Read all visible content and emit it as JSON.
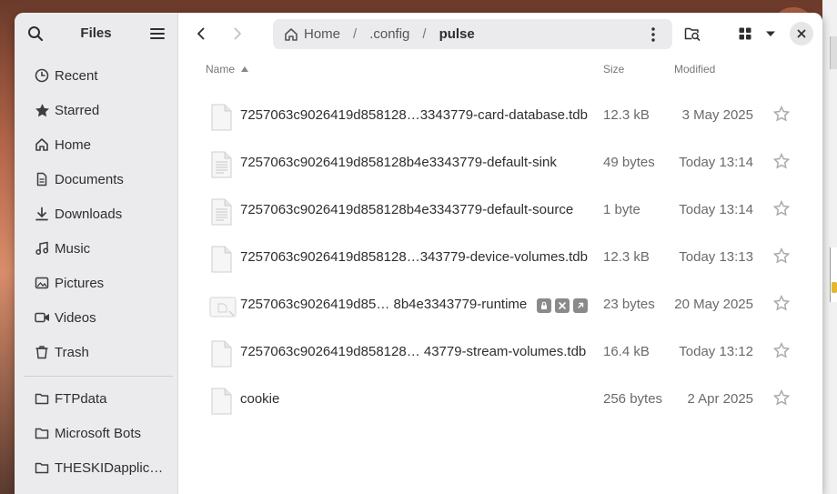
{
  "app": {
    "title": "Files"
  },
  "sidebar": {
    "places": [
      {
        "label": "Recent",
        "icon": "clock-icon"
      },
      {
        "label": "Starred",
        "icon": "star-icon"
      },
      {
        "label": "Home",
        "icon": "home-icon"
      },
      {
        "label": "Documents",
        "icon": "document-icon"
      },
      {
        "label": "Downloads",
        "icon": "download-icon"
      },
      {
        "label": "Music",
        "icon": "music-icon"
      },
      {
        "label": "Pictures",
        "icon": "picture-icon"
      },
      {
        "label": "Videos",
        "icon": "video-icon"
      },
      {
        "label": "Trash",
        "icon": "trash-icon"
      }
    ],
    "bookmarks": [
      {
        "label": "FTPdata",
        "icon": "folder-icon"
      },
      {
        "label": "Microsoft Bots",
        "icon": "folder-icon"
      },
      {
        "label": "THESKIDapplic…",
        "icon": "folder-icon"
      }
    ]
  },
  "pathbar": {
    "home": "Home",
    "sep1": "/",
    "config": ".config",
    "sep2": "/",
    "current": "pulse"
  },
  "columns": {
    "name": "Name",
    "size": "Size",
    "modified": "Modified"
  },
  "files": [
    {
      "name": "7257063c9026419d858128…3343779-card-database.tdb",
      "size": "12.3 kB",
      "modified": "3 May 2025",
      "icon": "file-icon"
    },
    {
      "name": "7257063c9026419d858128b4e3343779-default-sink",
      "size": "49 bytes",
      "modified": "Today 13:14",
      "icon": "text-file-icon"
    },
    {
      "name": "7257063c9026419d858128b4e3343779-default-source",
      "size": "1 byte",
      "modified": "Today 13:14",
      "icon": "text-file-icon"
    },
    {
      "name": "7257063c9026419d858128…343779-device-volumes.tdb",
      "size": "12.3 kB",
      "modified": "Today 13:13",
      "icon": "file-icon"
    },
    {
      "name": "7257063c9026419d85… 8b4e3343779-runtime",
      "size": "23 bytes",
      "modified": "20 May 2025",
      "icon": "broken-link-icon"
    },
    {
      "name": "7257063c9026419d858128… 43779-stream-volumes.tdb",
      "size": "16.4 kB",
      "modified": "Today 13:12",
      "icon": "file-icon"
    },
    {
      "name": "cookie",
      "size": "256 bytes",
      "modified": "2 Apr 2025",
      "icon": "file-icon"
    }
  ],
  "colors": {
    "sidebar_bg": "#ebebed",
    "window_bg": "#ffffff",
    "text": "#2e2e2e",
    "muted": "#6a6a6a"
  }
}
